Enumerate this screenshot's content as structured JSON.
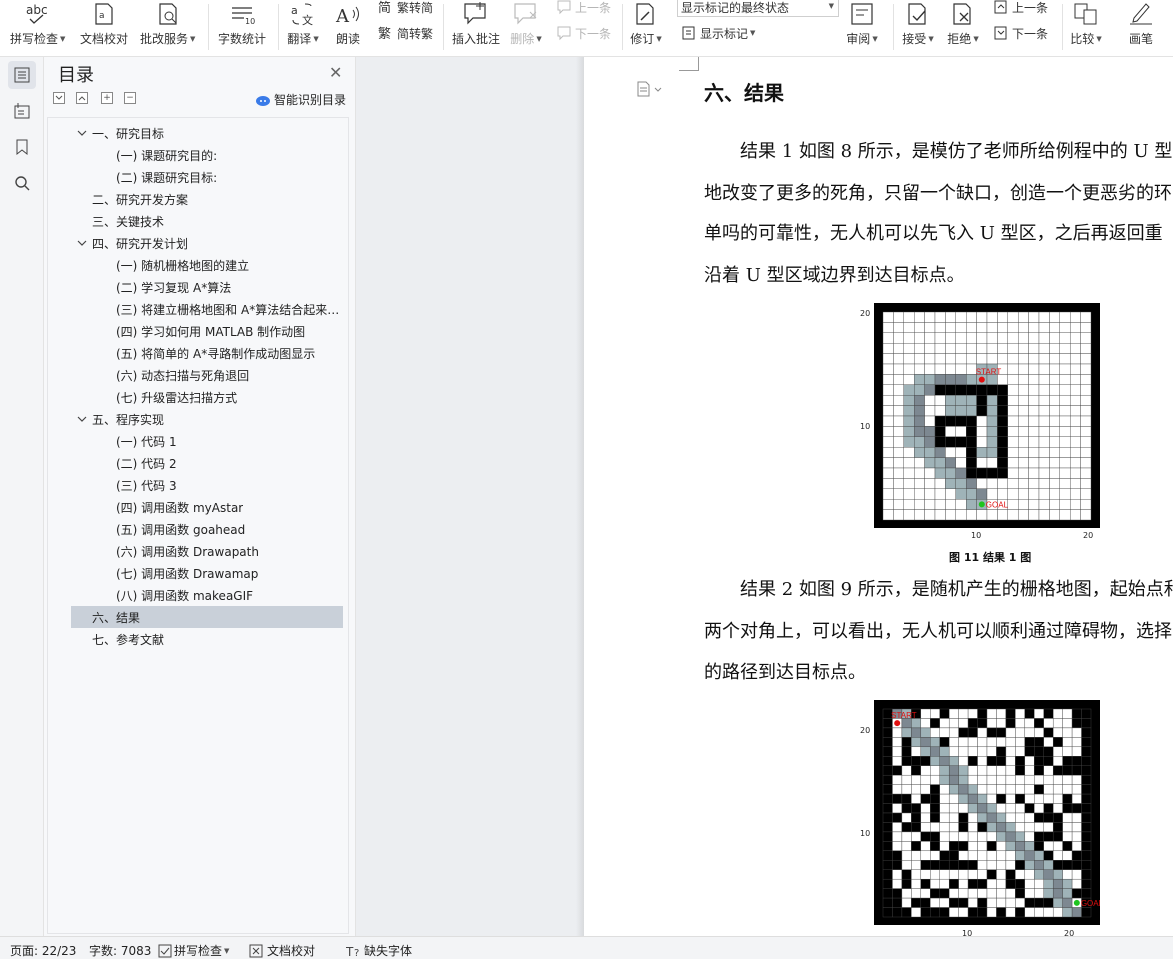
{
  "ribbon": {
    "spell_check": "拼写检查",
    "doc_proof": "文档校对",
    "revise_service": "批改服务",
    "word_count": "字数统计",
    "translate": "翻译",
    "read_aloud": "朗读",
    "trad_to_simp": "繁转简",
    "simp_to_trad": "简转繁",
    "insert_comment": "插入批注",
    "delete": "删除",
    "prev_comment": "上一条",
    "next_comment": "下一条",
    "track_changes": "修订",
    "markup_state": "显示标记的最终状态",
    "show_markup": "显示标记",
    "review": "审阅",
    "accept": "接受",
    "reject": "拒绝",
    "prev_change": "上一条",
    "next_change": "下一条",
    "compare": "比较",
    "ink": "画笔",
    "abc": "abc"
  },
  "toc": {
    "title": "目录",
    "smart_label": "智能识别目录",
    "items": [
      {
        "text": "一、研究目标",
        "level": 1,
        "expand": true
      },
      {
        "text": "(一) 课题研究目的:",
        "level": 2
      },
      {
        "text": "(二) 课题研究目标:",
        "level": 2
      },
      {
        "text": "二、研究开发方案",
        "level": 1
      },
      {
        "text": "三、关键技术",
        "level": 1
      },
      {
        "text": "四、研究开发计划",
        "level": 1,
        "expand": true
      },
      {
        "text": "(一) 随机栅格地图的建立",
        "level": 2
      },
      {
        "text": "(二) 学习复现 A*算法",
        "level": 2
      },
      {
        "text": "(三) 将建立栅格地图和 A*算法结合起来，实现A*寻路",
        "level": 2
      },
      {
        "text": "(四) 学习如何用 MATLAB 制作动图",
        "level": 2
      },
      {
        "text": "(五) 将简单的 A*寻路制作成动图显示",
        "level": 2
      },
      {
        "text": "(六) 动态扫描与死角退回",
        "level": 2
      },
      {
        "text": "(七) 升级雷达扫描方式",
        "level": 2
      },
      {
        "text": "五、程序实现",
        "level": 1,
        "expand": true
      },
      {
        "text": "(一) 代码 1",
        "level": 2
      },
      {
        "text": "(二) 代码 2",
        "level": 2
      },
      {
        "text": "(三) 代码 3",
        "level": 2
      },
      {
        "text": "(四) 调用函数 myAstar",
        "level": 2
      },
      {
        "text": "(五) 调用函数 goahead",
        "level": 2
      },
      {
        "text": "(六) 调用函数 Drawapath",
        "level": 2
      },
      {
        "text": "(七) 调用函数 Drawamap",
        "level": 2
      },
      {
        "text": "(八) 调用函数 makeaGIF",
        "level": 2
      },
      {
        "text": "六、结果",
        "level": 1,
        "selected": true
      },
      {
        "text": "七、参考文献",
        "level": 1
      }
    ]
  },
  "document": {
    "heading": "六、结果",
    "para1": [
      "结果 1 如图 8 所示，是模仿了老师所给例程中的 U 型",
      "地改变了更多的死角，只留一个缺口，创造一个更恶劣的环",
      "单吗的可靠性，无人机可以先飞入 U 型区，之后再返回重",
      "沿着 U 型区域边界到达目标点。"
    ],
    "fig1_caption": "图  11 结果 1 图",
    "para2": [
      "结果 2 如图 9 所示，是随机产生的栅格地图，起始点和",
      "两个对角上，可以看出，无人机可以顺利通过障碍物，选择",
      "的路径到达目标点。"
    ],
    "fig1": {
      "start_label": "START",
      "goal_label": "GOAL",
      "y_ticks": [
        "20",
        "10"
      ],
      "x_ticks": [
        "10",
        "20"
      ]
    },
    "fig2": {
      "start_label": "START",
      "goal_label": "GOAL",
      "y_ticks": [
        "20",
        "10"
      ],
      "x_ticks": [
        "10",
        "20"
      ]
    }
  },
  "status": {
    "page": "页面: 22/23",
    "words": "字数: 7083",
    "spell": "拼写检查",
    "proof": "文档校对",
    "missing_font": "缺失字体"
  },
  "colors": {
    "selected_row": "#c9d0d9",
    "start": "#e01010",
    "goal": "#1fc41f",
    "path_light": "#9fb3b8",
    "path_dark": "#7d8891"
  }
}
